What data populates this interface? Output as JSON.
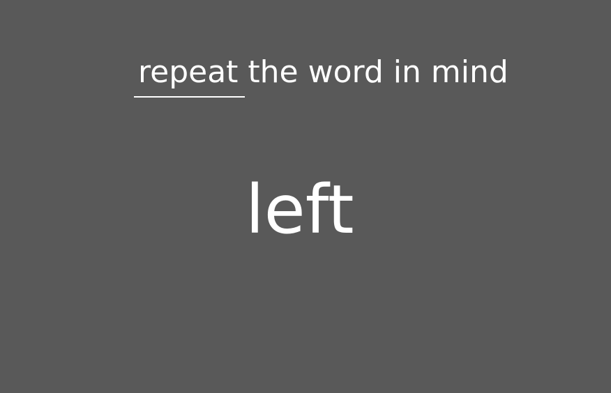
{
  "instruction": {
    "emphasis": "repeat",
    "rest": "the word in mind"
  },
  "stimulus": {
    "word": "left"
  },
  "colors": {
    "background": "#595959",
    "text": "#ffffff"
  }
}
